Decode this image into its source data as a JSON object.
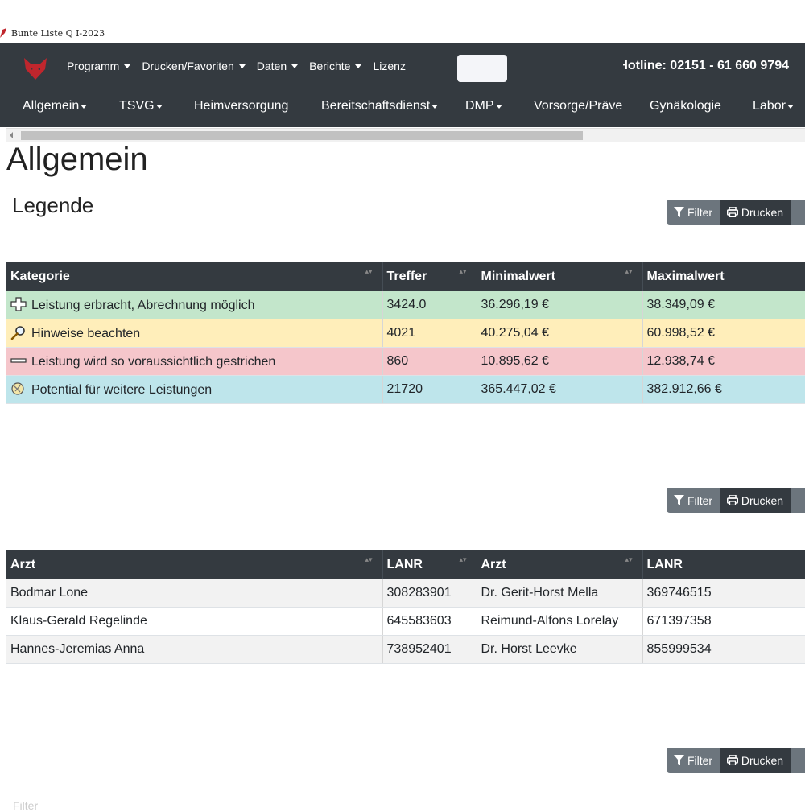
{
  "window": {
    "title": "Bunte Liste Q I-2023"
  },
  "nav1": {
    "menu": [
      {
        "label": "Programm",
        "dropdown": true
      },
      {
        "label": "Drucken/Favoriten",
        "dropdown": true
      },
      {
        "label": "Daten",
        "dropdown": true
      },
      {
        "label": "Berichte",
        "dropdown": true
      },
      {
        "label": "Lizenz",
        "dropdown": false
      }
    ],
    "hotline": "Hotline: 02151 - 61 660 9794",
    "brand_color": "#c0262d"
  },
  "nav2": {
    "items": [
      {
        "label": "Allgemein",
        "dropdown": true
      },
      {
        "label": "TSVG",
        "dropdown": true
      },
      {
        "label": "Heimversorgung",
        "dropdown": false
      },
      {
        "label": "Bereitschaftsdienst",
        "dropdown": true
      },
      {
        "label": "DMP",
        "dropdown": true
      },
      {
        "label": "Vorsorge/Präve",
        "dropdown": false
      },
      {
        "label": "Gynäkologie",
        "dropdown": false
      },
      {
        "label": "Labor",
        "dropdown": true
      }
    ]
  },
  "page": {
    "title": "Allgemein",
    "subtitle": "Legende"
  },
  "buttons": {
    "filter": "Filter",
    "print": "Drucken"
  },
  "legend_table": {
    "headers": [
      "Kategorie",
      "Treffer",
      "Minimalwert",
      "Maximalwert"
    ],
    "rows": [
      {
        "icon": "plus-icon",
        "color": "#c3e6cb",
        "kategorie": "Leistung erbracht, Abrechnung möglich",
        "treffer": "3424.0",
        "min": "36.296,19 €",
        "max": "38.349,09 €"
      },
      {
        "icon": "magnifier-icon",
        "color": "#ffeeba",
        "kategorie": "Hinweise beachten",
        "treffer": "4021",
        "min": "40.275,04 €",
        "max": "60.998,52 €"
      },
      {
        "icon": "minus-icon",
        "color": "#f5c6cb",
        "kategorie": "Leistung wird so voraussichtlich gestrichen",
        "treffer": "860",
        "min": "10.895,62 €",
        "max": "12.938,74 €"
      },
      {
        "icon": "potential-icon",
        "color": "#bee5eb",
        "kategorie": "Potential für weitere Leistungen",
        "treffer": "21720",
        "min": "365.447,02 €",
        "max": "382.912,66 €"
      }
    ]
  },
  "doctors_table": {
    "headers": [
      "Arzt",
      "LANR",
      "Arzt",
      "LANR"
    ],
    "rows": [
      [
        "Bodmar Lone",
        "308283901",
        "Dr. Gerit-Horst Mella",
        "369746515"
      ],
      [
        "Klaus-Gerald Regelinde",
        "645583603",
        "Reimund-Alfons Lorelay",
        "671397358"
      ],
      [
        "Hannes-Jeremias Anna",
        "738952401",
        "Dr. Horst Leevke",
        "855999534"
      ]
    ]
  },
  "bottom_text": "Filter"
}
